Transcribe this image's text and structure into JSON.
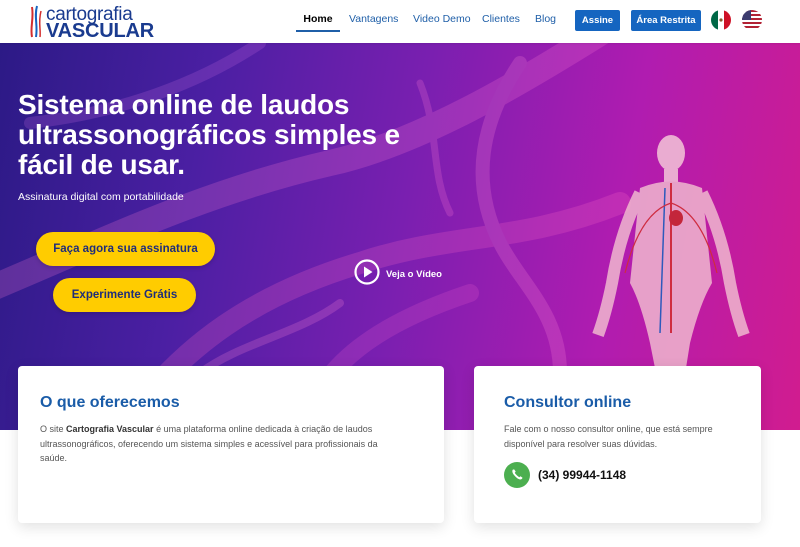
{
  "brand": {
    "name_top": "cartografia",
    "name_bottom": "VASCULAR"
  },
  "nav": {
    "items": [
      "Home",
      "Vantagens",
      "Video Demo",
      "Clientes",
      "Blog"
    ],
    "subscribe_label": "Assine",
    "restricted_label": "Área Restrita",
    "languages": [
      "mexico-flag-icon",
      "usa-flag-icon"
    ]
  },
  "hero": {
    "title": "Sistema online de laudos ultrassonográficos simples e fácil de usar.",
    "subtitle": "Assinatura digital com portabilidade",
    "cta_primary": "Faça agora sua assinatura",
    "cta_secondary": "Experimente Grátis",
    "video_label": "Veja o Vídeo"
  },
  "offer_card": {
    "title": "O que oferecemos",
    "text_prefix": "O site ",
    "text_brand": "Cartografia Vascular",
    "text_rest": " é uma plataforma online dedicada à criação de laudos ultrassonográficos, oferecendo um sistema simples e acessível para profissionais da saúde."
  },
  "consult_card": {
    "title": "Consultor online",
    "text": "Fale com o nosso consultor online, que está sempre disponível para resolver suas dúvidas.",
    "phone": "(34) 99944-1148"
  },
  "colors": {
    "primary": "#1565c0",
    "accent_yellow": "#ffcc00",
    "title_blue": "#1a5ca8",
    "whatsapp_green": "#4caf50"
  }
}
